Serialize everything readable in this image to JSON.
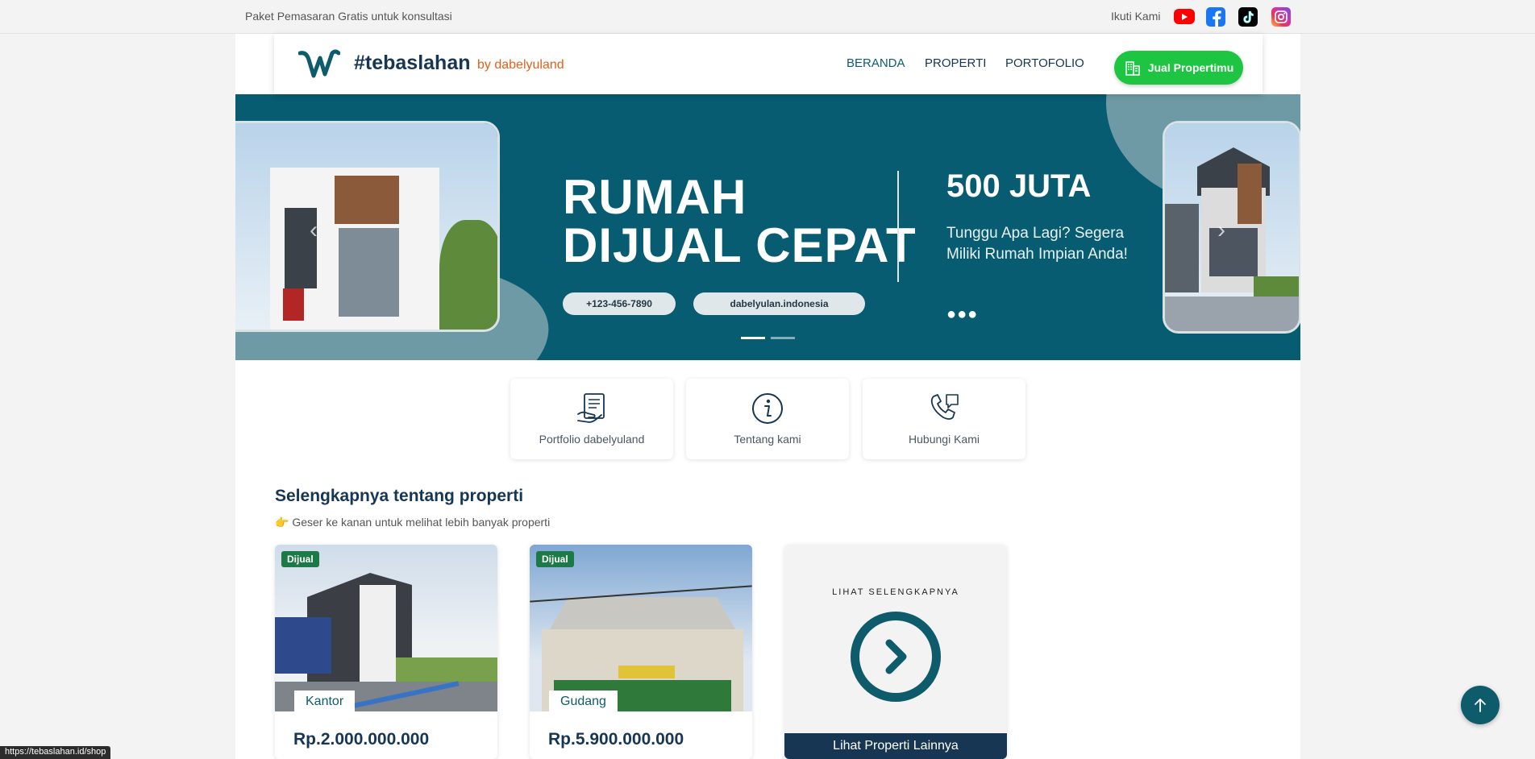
{
  "topbar": {
    "promo": "Paket Pemasaran Gratis untuk konsultasi",
    "follow_label": "Ikuti Kami",
    "socials": [
      "youtube-icon",
      "facebook-icon",
      "tiktok-icon",
      "instagram-icon"
    ]
  },
  "header": {
    "brand": "#tebaslahan",
    "byline": "by dabelyuland",
    "nav": {
      "beranda": "BERANDA",
      "properti": "PROPERTI",
      "portfolio": "PORTOFOLIO"
    },
    "cta": "Jual Propertimu"
  },
  "banner": {
    "headline_line1": "RUMAH",
    "headline_line2": "DIJUAL CEPAT",
    "phone": "+123-456-7890",
    "web": "dabelyulan.indonesia",
    "price": "500 JUTA",
    "tagline": "Tunggu Apa Lagi? Segera Miliki Rumah Impian Anda!",
    "dots": "●●●",
    "prev": "‹",
    "next": "›"
  },
  "quick_links": [
    {
      "label": "Portfolio dabelyuland",
      "icon": "portfolio-doc-icon"
    },
    {
      "label": "Tentang kami",
      "icon": "info-icon"
    },
    {
      "label": "Hubungi Kami",
      "icon": "phone-chat-icon"
    }
  ],
  "section": {
    "title": "Selengkapnya tentang properti",
    "subtitle": "👉 Geser ke kanan untuk melihat lebih banyak properti"
  },
  "properties": [
    {
      "badge": "Dijual",
      "type": "Kantor",
      "price": "Rp.2.000.000.000"
    },
    {
      "badge": "Dijual",
      "type": "Gudang",
      "price": "Rp.5.900.000.000"
    }
  ],
  "more_card": {
    "title": "LIHAT SELENGKAPNYA",
    "button": "Lihat Properti Lainnya"
  },
  "status_url": "https://tebaslahan.id/shop",
  "colors": {
    "brand_dark": "#163654",
    "accent_teal": "#0e5c6b",
    "banner_bg": "#075c72",
    "cta_green": "#1ec542",
    "byline_orange": "#e2601c",
    "badge_green": "#1c7a46"
  }
}
